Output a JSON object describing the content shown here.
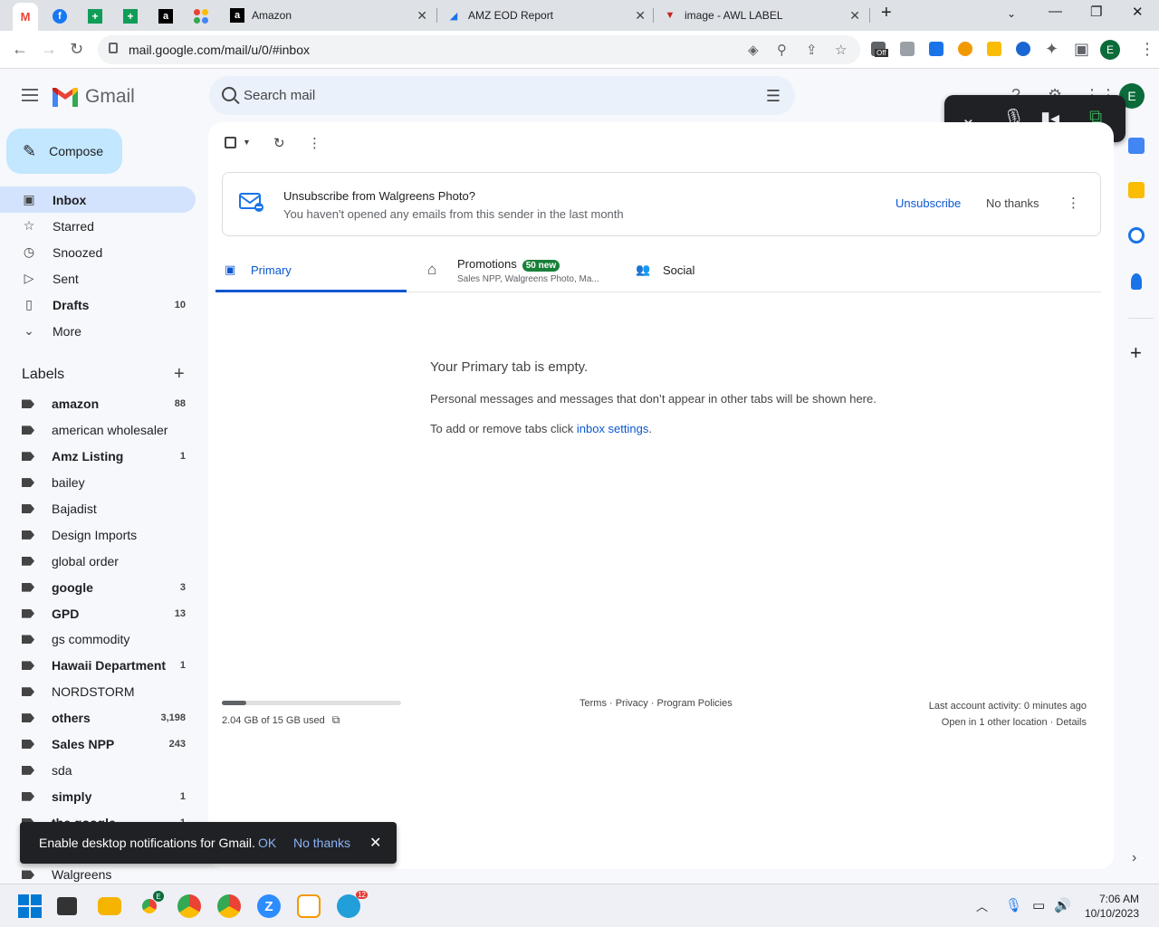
{
  "browser": {
    "tabs": [
      {
        "title": "Amazon"
      },
      {
        "title": "AMZ EOD Report"
      },
      {
        "title": "image - AWL LABEL"
      }
    ],
    "url": "mail.google.com/mail/u/0/#inbox",
    "profile_initial": "E",
    "ext_off_badge": "Off"
  },
  "gmail": {
    "logo_text": "Gmail",
    "search_placeholder": "Search mail",
    "avatar_initial": "E",
    "compose_label": "Compose",
    "nav": [
      {
        "label": "Inbox",
        "count": ""
      },
      {
        "label": "Starred",
        "count": ""
      },
      {
        "label": "Snoozed",
        "count": ""
      },
      {
        "label": "Sent",
        "count": ""
      },
      {
        "label": "Drafts",
        "count": "10"
      },
      {
        "label": "More",
        "count": ""
      }
    ],
    "labels_title": "Labels",
    "labels": [
      {
        "label": "amazon",
        "count": "88"
      },
      {
        "label": "american wholesaler",
        "count": ""
      },
      {
        "label": "Amz Listing",
        "count": "1"
      },
      {
        "label": "bailey",
        "count": ""
      },
      {
        "label": "Bajadist",
        "count": ""
      },
      {
        "label": "Design Imports",
        "count": ""
      },
      {
        "label": "global order",
        "count": ""
      },
      {
        "label": "google",
        "count": "3"
      },
      {
        "label": "GPD",
        "count": "13"
      },
      {
        "label": "gs commodity",
        "count": ""
      },
      {
        "label": "Hawaii Department",
        "count": "1"
      },
      {
        "label": "NORDSTORM",
        "count": ""
      },
      {
        "label": "others",
        "count": "3,198"
      },
      {
        "label": "Sales NPP",
        "count": "243"
      },
      {
        "label": "sda",
        "count": ""
      },
      {
        "label": "simply",
        "count": "1"
      },
      {
        "label": "the google",
        "count": "1"
      },
      {
        "label": "",
        "count": ""
      },
      {
        "label": "Walgreens",
        "count": ""
      }
    ],
    "unsubscribe": {
      "title": "Unsubscribe from Walgreens Photo?",
      "subtitle": "You haven't opened any emails from this sender in the last month",
      "action": "Unsubscribe",
      "dismiss": "No thanks"
    },
    "tabs": {
      "primary": "Primary",
      "promotions": "Promotions",
      "promotions_badge": "50 new",
      "promotions_snippet": "Sales NPP, Walgreens Photo, Ma...",
      "social": "Social"
    },
    "empty": {
      "heading": "Your Primary tab is empty.",
      "line1": "Personal messages and messages that don’t appear in other tabs will be shown here.",
      "line2_prefix": "To add or remove tabs click ",
      "line2_link": "inbox settings",
      "line2_suffix": "."
    },
    "storage": {
      "text": "2.04 GB of 15 GB used",
      "used_fraction": 0.136
    },
    "footer_links": "Terms · Privacy · Program Policies",
    "activity_line1": "Last account activity: 0 minutes ago",
    "activity_line2": "Open in 1 other location · Details",
    "toast": {
      "message": "Enable desktop notifications for Gmail.",
      "ok": "OK",
      "no_thanks": "No thanks"
    }
  },
  "taskbar": {
    "time": "7:06 AM",
    "date": "10/10/2023",
    "telegram_badge": "12",
    "chrome_badge": "E"
  },
  "colors": {
    "accent": "#0b57d0",
    "compose_bg": "#c2e7ff",
    "active_nav": "#d3e3fd",
    "badge_green": "#188038"
  }
}
